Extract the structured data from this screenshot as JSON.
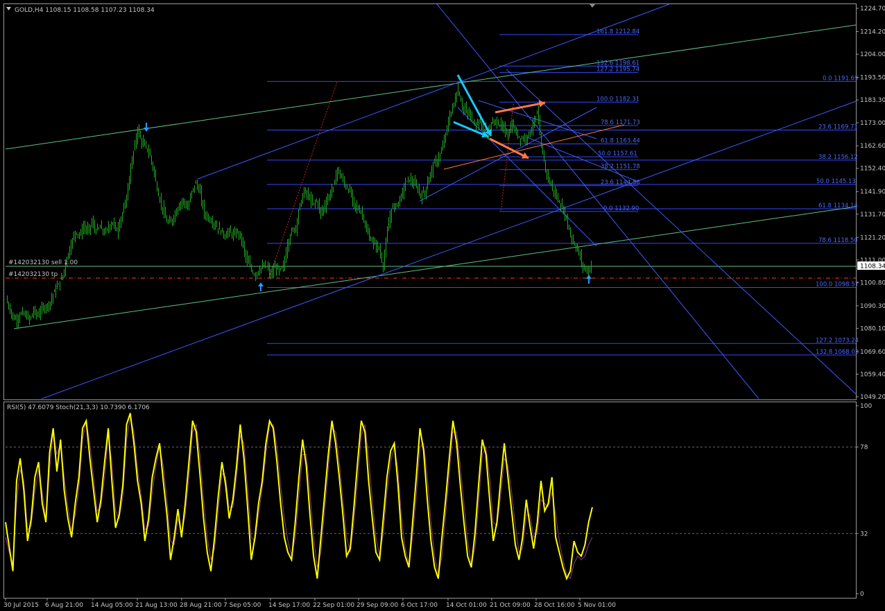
{
  "main_panel": {
    "title": "GOLD,H4  1108.15 1108.58 1107.23 1108.34",
    "current_price": "1108.34",
    "order_sell": "#142032130 sell 1.00",
    "order_tp": "#142032130 tp"
  },
  "indicator_panel": {
    "title": "RSI(5) 47.6079   Stoch(21,3,3) 10.7390 6.1706"
  },
  "colors": {
    "background": "#000000",
    "candles": "#22aa22",
    "fib": "#3348ff",
    "trend_green": "#5fc28a",
    "trend_blue": "#3a5cff",
    "rsi": "#ffff00",
    "stoch": "#8a3a9a",
    "arrow_cyan": "#19c8ff",
    "arrow_orange": "#ff7a40",
    "tp_line": "#ff3a1a"
  },
  "chart_data": [
    {
      "type": "candlestick",
      "symbol": "GOLD",
      "timeframe": "H4",
      "ylim": [
        1049.2,
        1224.7
      ],
      "y_ticks": [
        "1224.70",
        "1214.20",
        "1204.00",
        "1193.50",
        "1183.30",
        "1173.00",
        "1162.60",
        "1152.40",
        "1141.90",
        "1131.70",
        "1121.20",
        "1111.00",
        "1100.80",
        "1090.30",
        "1080.10",
        "1069.60",
        "1059.40",
        "1049.20"
      ],
      "x_ticks": [
        "30 Jul 2015",
        "6 Aug 21:00",
        "14 Aug 05:00",
        "21 Aug 13:00",
        "28 Aug 21:00",
        "7 Sep 05:00",
        "14 Sep 17:00",
        "22 Sep 01:00",
        "29 Sep 09:00",
        "6 Oct 17:00",
        "14 Oct 01:00",
        "21 Oct 09:00",
        "28 Oct 16:00",
        "5 Nov 01:00"
      ],
      "close_path": [
        [
          0,
          1098
        ],
        [
          6,
          1095
        ],
        [
          12,
          1090
        ],
        [
          18,
          1085
        ],
        [
          24,
          1084
        ],
        [
          30,
          1087
        ],
        [
          36,
          1086
        ],
        [
          42,
          1084
        ],
        [
          48,
          1088
        ],
        [
          54,
          1086
        ],
        [
          60,
          1089
        ],
        [
          66,
          1090
        ],
        [
          72,
          1092
        ],
        [
          78,
          1097
        ],
        [
          84,
          1100
        ],
        [
          90,
          1104
        ],
        [
          96,
          1112
        ],
        [
          102,
          1118
        ],
        [
          108,
          1124
        ],
        [
          114,
          1122
        ],
        [
          120,
          1126
        ],
        [
          126,
          1124
        ],
        [
          132,
          1128
        ],
        [
          138,
          1124
        ],
        [
          144,
          1126
        ],
        [
          150,
          1123
        ],
        [
          156,
          1126
        ],
        [
          162,
          1128
        ],
        [
          168,
          1124
        ],
        [
          174,
          1130
        ],
        [
          180,
          1136
        ],
        [
          186,
          1148
        ],
        [
          192,
          1160
        ],
        [
          198,
          1170
        ],
        [
          204,
          1164
        ],
        [
          210,
          1162
        ],
        [
          216,
          1158
        ],
        [
          222,
          1150
        ],
        [
          228,
          1140
        ],
        [
          234,
          1134
        ],
        [
          240,
          1128
        ],
        [
          246,
          1128
        ],
        [
          252,
          1132
        ],
        [
          258,
          1136
        ],
        [
          264,
          1138
        ],
        [
          270,
          1134
        ],
        [
          276,
          1142
        ],
        [
          282,
          1146
        ],
        [
          288,
          1141
        ],
        [
          294,
          1132
        ],
        [
          300,
          1130
        ],
        [
          306,
          1128
        ],
        [
          312,
          1126
        ],
        [
          318,
          1124
        ],
        [
          324,
          1122
        ],
        [
          330,
          1124
        ],
        [
          336,
          1122
        ],
        [
          342,
          1124
        ],
        [
          348,
          1120
        ],
        [
          354,
          1112
        ],
        [
          360,
          1108
        ],
        [
          366,
          1104
        ],
        [
          372,
          1106
        ],
        [
          378,
          1108
        ],
        [
          384,
          1108
        ],
        [
          390,
          1104
        ],
        [
          396,
          1108
        ],
        [
          402,
          1106
        ],
        [
          408,
          1108
        ],
        [
          414,
          1118
        ],
        [
          420,
          1124
        ],
        [
          426,
          1126
        ],
        [
          432,
          1136
        ],
        [
          438,
          1142
        ],
        [
          444,
          1140
        ],
        [
          450,
          1136
        ],
        [
          456,
          1138
        ],
        [
          462,
          1132
        ],
        [
          468,
          1136
        ],
        [
          474,
          1140
        ],
        [
          480,
          1144
        ],
        [
          486,
          1152
        ],
        [
          492,
          1148
        ],
        [
          498,
          1144
        ],
        [
          504,
          1142
        ],
        [
          510,
          1136
        ],
        [
          516,
          1134
        ],
        [
          522,
          1132
        ],
        [
          528,
          1124
        ],
        [
          534,
          1120
        ],
        [
          540,
          1118
        ],
        [
          546,
          1116
        ],
        [
          552,
          1108
        ],
        [
          558,
          1124
        ],
        [
          564,
          1134
        ],
        [
          570,
          1136
        ],
        [
          576,
          1138
        ],
        [
          582,
          1144
        ],
        [
          588,
          1148
        ],
        [
          594,
          1146
        ],
        [
          600,
          1144
        ],
        [
          606,
          1140
        ],
        [
          612,
          1142
        ],
        [
          618,
          1148
        ],
        [
          624,
          1154
        ],
        [
          630,
          1156
        ],
        [
          636,
          1160
        ],
        [
          642,
          1168
        ],
        [
          648,
          1176
        ],
        [
          654,
          1182
        ],
        [
          660,
          1188
        ],
        [
          666,
          1180
        ],
        [
          672,
          1178
        ],
        [
          678,
          1176
        ],
        [
          684,
          1172
        ],
        [
          690,
          1174
        ],
        [
          696,
          1170
        ],
        [
          702,
          1168
        ],
        [
          708,
          1172
        ],
        [
          714,
          1174
        ],
        [
          720,
          1172
        ],
        [
          726,
          1170
        ],
        [
          732,
          1168
        ],
        [
          738,
          1172
        ],
        [
          744,
          1168
        ],
        [
          750,
          1166
        ],
        [
          756,
          1166
        ],
        [
          762,
          1168
        ],
        [
          768,
          1172
        ],
        [
          774,
          1178
        ],
        [
          780,
          1162
        ],
        [
          786,
          1152
        ],
        [
          792,
          1146
        ],
        [
          798,
          1142
        ],
        [
          804,
          1138
        ],
        [
          810,
          1134
        ],
        [
          816,
          1130
        ],
        [
          822,
          1122
        ],
        [
          828,
          1118
        ],
        [
          834,
          1114
        ],
        [
          840,
          1108
        ],
        [
          846,
          1106
        ],
        [
          852,
          1108
        ]
      ],
      "fib_levels": [
        {
          "label": "161.8 1212.84",
          "price": 1212.84
        },
        {
          "label": "132.6 1198.61",
          "price": 1198.61
        },
        {
          "label": "127.2 1195.74",
          "price": 1195.74
        },
        {
          "label": "0.0 1191.69",
          "price": 1191.69
        },
        {
          "label": "100.0 1182.31",
          "price": 1182.31
        },
        {
          "label": "78.6 1171.73",
          "price": 1171.73
        },
        {
          "label": "23.6 1169.71",
          "price": 1169.71
        },
        {
          "label": "61.8 1163.44",
          "price": 1163.44
        },
        {
          "label": "50.0 1157.61",
          "price": 1157.61
        },
        {
          "label": "38.2 1156.12",
          "price": 1156.12
        },
        {
          "label": "38.2 1151.78",
          "price": 1151.78
        },
        {
          "label": "23.6 1144.56",
          "price": 1144.56
        },
        {
          "label": "50.0 1145.13",
          "price": 1145.13
        },
        {
          "label": "0.0 1132.90",
          "price": 1132.9
        },
        {
          "label": "61.8 1134.14",
          "price": 1134.14
        },
        {
          "label": "78.6 1118.50",
          "price": 1118.5
        },
        {
          "label": "100.0 1098.57",
          "price": 1098.57
        },
        {
          "label": "127.2 1073.24",
          "price": 1073.24
        },
        {
          "label": "132.8 1068.03",
          "price": 1068.03
        }
      ]
    },
    {
      "type": "line",
      "title": "RSI(5) 47.6079   Stoch(21,3,3) 10.7390 6.1706",
      "ylim": [
        0,
        100
      ],
      "y_ticks": [
        "100",
        "78",
        "32",
        "0"
      ],
      "series": [
        {
          "name": "RSI(5)",
          "values": [
            38,
            25,
            12,
            60,
            72,
            55,
            28,
            40,
            62,
            70,
            48,
            38,
            75,
            88,
            65,
            82,
            55,
            40,
            30,
            48,
            62,
            88,
            92,
            72,
            55,
            38,
            50,
            70,
            88,
            60,
            35,
            42,
            58,
            90,
            96,
            80,
            60,
            48,
            28,
            40,
            62,
            72,
            80,
            60,
            42,
            18,
            30,
            45,
            30,
            48,
            70,
            92,
            86,
            64,
            40,
            22,
            12,
            30,
            52,
            70,
            58,
            40,
            50,
            68,
            90,
            72,
            46,
            18,
            30,
            48,
            60,
            80,
            92,
            88,
            70,
            48,
            30,
            22,
            18,
            38,
            62,
            82,
            68,
            42,
            20,
            8,
            30,
            52,
            74,
            92,
            80,
            62,
            42,
            20,
            24,
            46,
            70,
            92,
            86,
            60,
            40,
            22,
            18,
            40,
            62,
            76,
            80,
            58,
            30,
            20,
            14,
            38,
            62,
            88,
            76,
            50,
            28,
            14,
            8,
            30,
            50,
            72,
            92,
            80,
            58,
            38,
            20,
            14,
            32,
            58,
            82,
            74,
            50,
            28,
            38,
            60,
            80,
            62,
            44,
            26,
            18,
            30,
            50,
            36,
            24,
            38,
            60,
            44,
            48,
            62,
            30,
            22,
            14,
            8,
            12,
            28,
            22,
            20,
            26,
            38,
            46
          ]
        },
        {
          "name": "Stoch(21,3,3)",
          "values": [
            30,
            22,
            16,
            48,
            66,
            60,
            34,
            36,
            54,
            66,
            54,
            40,
            66,
            86,
            74,
            80,
            62,
            46,
            34,
            42,
            56,
            82,
            92,
            80,
            62,
            44,
            46,
            62,
            84,
            70,
            44,
            40,
            52,
            82,
            94,
            86,
            66,
            52,
            34,
            36,
            54,
            68,
            78,
            68,
            50,
            28,
            26,
            40,
            32,
            42,
            62,
            86,
            90,
            74,
            50,
            30,
            18,
            24,
            44,
            64,
            62,
            46,
            46,
            62,
            84,
            80,
            56,
            30,
            28,
            42,
            56,
            74,
            90,
            90,
            78,
            58,
            40,
            28,
            20,
            30,
            52,
            74,
            74,
            54,
            30,
            14,
            22,
            44,
            66,
            88,
            86,
            70,
            50,
            30,
            22,
            38,
            60,
            84,
            90,
            72,
            50,
            30,
            20,
            32,
            54,
            70,
            78,
            66,
            40,
            24,
            16,
            30,
            52,
            78,
            80,
            62,
            38,
            20,
            10,
            20,
            42,
            64,
            86,
            86,
            68,
            48,
            28,
            16,
            24,
            48,
            74,
            78,
            62,
            38,
            36,
            52,
            72,
            68,
            54,
            36,
            22,
            24,
            42,
            42,
            30,
            32,
            50,
            48,
            46,
            54,
            42,
            28,
            18,
            10,
            8,
            16,
            20,
            18,
            20,
            26,
            30
          ]
        }
      ]
    }
  ]
}
